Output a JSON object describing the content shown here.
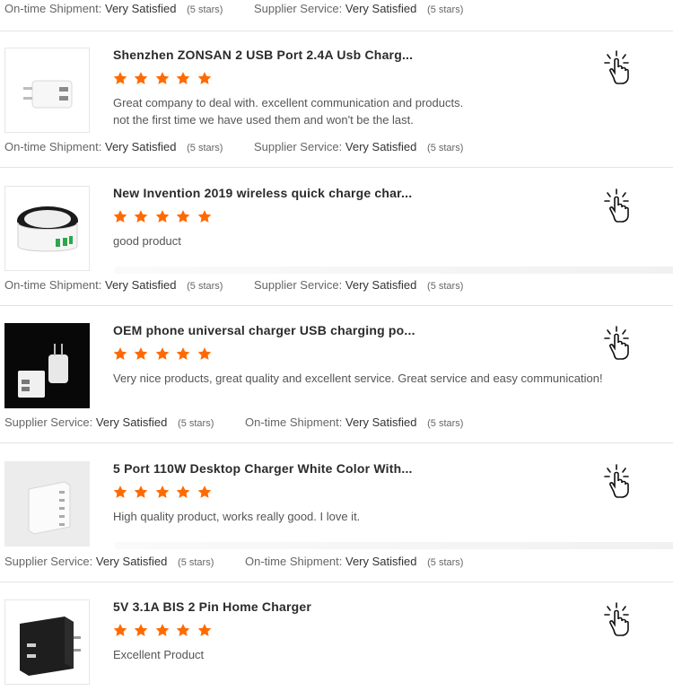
{
  "ratings": [
    {
      "a_label": "On-time Shipment:",
      "a_value": "Very Satisfied",
      "a_stars": "(5 stars)",
      "b_label": "Supplier Service:",
      "b_value": "Very Satisfied",
      "b_stars": "(5 stars)"
    },
    {
      "a_label": "On-time Shipment:",
      "a_value": "Very Satisfied",
      "a_stars": "(5 stars)",
      "b_label": "Supplier Service:",
      "b_value": "Very Satisfied",
      "b_stars": "(5 stars)"
    },
    {
      "a_label": "On-time Shipment:",
      "a_value": "Very Satisfied",
      "a_stars": "(5 stars)",
      "b_label": "Supplier Service:",
      "b_value": "Very Satisfied",
      "b_stars": "(5 stars)"
    },
    {
      "a_label": "Supplier Service:",
      "a_value": "Very Satisfied",
      "a_stars": "(5 stars)",
      "b_label": "On-time Shipment:",
      "b_value": "Very Satisfied",
      "b_stars": "(5 stars)"
    },
    {
      "a_label": "Supplier Service:",
      "a_value": "Very Satisfied",
      "a_stars": "(5 stars)",
      "b_label": "On-time Shipment:",
      "b_value": "Very Satisfied",
      "b_stars": "(5 stars)"
    }
  ],
  "reviews": [
    {
      "title": "Shenzhen ZONSAN 2 USB Port 2.4A Usb Charg...",
      "rating": 5,
      "comment": "Great company to deal with. excellent communication and products. not the first time we have used them and won't be the last.",
      "image": "white-usb-wall-charger"
    },
    {
      "title": "New Invention 2019 wireless quick charge char...",
      "rating": 5,
      "comment": "good product",
      "image": "wireless-charging-dock"
    },
    {
      "title": "OEM phone universal charger USB charging po...",
      "rating": 5,
      "comment": "Very nice products, great quality and excellent service. Great service and easy communication!",
      "image": "white-chargers-on-black"
    },
    {
      "title": "5 Port 110W Desktop Charger White Color With...",
      "rating": 5,
      "comment": "High quality product, works really good. I love it.",
      "image": "desktop-charger-white"
    },
    {
      "title": "5V 3.1A BIS 2 Pin Home Charger",
      "rating": 5,
      "comment": "Excellent Product",
      "image": "black-wall-charger"
    }
  ],
  "colors": {
    "star": "#ff6a00",
    "divider": "#e3e3e3",
    "text": "#333333"
  },
  "icons": {
    "tap": "tap-hand-icon",
    "star": "star-icon"
  }
}
